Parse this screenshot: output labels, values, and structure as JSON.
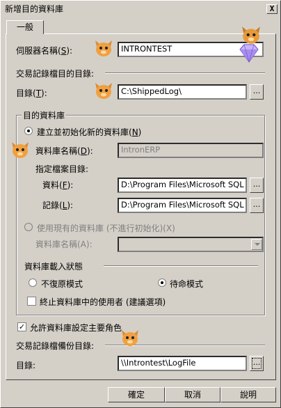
{
  "window": {
    "title": "新增目的資料庫",
    "close_label": "X"
  },
  "tab": {
    "label": "一般"
  },
  "server": {
    "label": "伺服器名稱(S):",
    "label_main": "伺服器名稱(",
    "label_key": "S",
    "label_end": "):",
    "value": "INTRONTEST"
  },
  "section_log_dest": {
    "title": "交易記錄檔目的目錄:"
  },
  "dir1": {
    "label_main": "目錄(",
    "label_key": "T",
    "label_end": "):",
    "value": "C:\\ShippedLog\\",
    "browse": "..."
  },
  "dest_db": {
    "group_title": "目的資料庫",
    "create_new": {
      "label_main": "建立並初始化新的資料庫(",
      "label_key": "N",
      "label_end": ")",
      "selected": true
    },
    "db_name": {
      "label_main": "資料庫名稱(",
      "label_key": "D",
      "label_end": "):",
      "value": "IntronERP"
    },
    "file_dir_title": "指定檔案目錄:",
    "data": {
      "label_main": "資料(",
      "label_key": "F",
      "label_end": "):",
      "value": "D:\\Program Files\\Microsoft SQL Serve",
      "browse": "..."
    },
    "log": {
      "label_main": "記錄(",
      "label_key": "L",
      "label_end": "):",
      "value": "D:\\Program Files\\Microsoft SQL Serve",
      "browse": "..."
    },
    "use_existing": {
      "label": "使用現有的資料庫 (不進行初始化)(X)",
      "selected": false
    },
    "existing_name": {
      "label": "資料庫名稱(A):",
      "value": ""
    }
  },
  "load_state": {
    "title": "資料庫載入狀態",
    "no_recovery": {
      "label": "不復原模式",
      "selected": false
    },
    "standby": {
      "label": "待命模式",
      "selected": true
    },
    "terminate_users": {
      "label": "終止資料庫中的使用者 (建議選項)",
      "checked": false
    }
  },
  "allow_primary": {
    "label": "允許資料庫設定主要角色",
    "checked": true
  },
  "section_backup": {
    "title": "交易記錄檔備份目錄:"
  },
  "dir2": {
    "label": "目錄:",
    "value": "\\\\Introntest\\LogFile",
    "browse": "..."
  },
  "buttons": {
    "ok": "確定",
    "cancel": "取消",
    "help": "說明"
  },
  "icons": {
    "mascot": "cat-mascot-icon",
    "diamond": "diamond-icon"
  }
}
